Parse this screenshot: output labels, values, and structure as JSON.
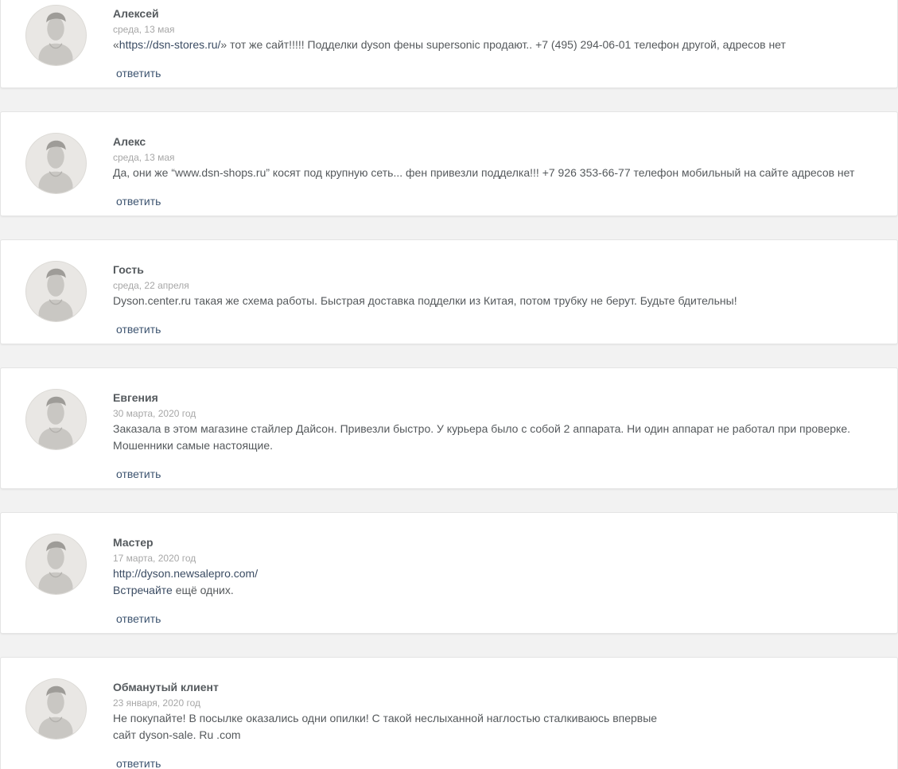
{
  "comments": [
    {
      "author": "Алексей",
      "date": "среда, 13 мая",
      "text_prefix": "«",
      "link": "https://dsn-stores.ru/",
      "text_suffix": "» тот же сайт!!!!! Подделки dyson фены supersonic продают.. +7 (495) 294-06-01 телефон другой, адресов нет",
      "reply_label": "ответить"
    },
    {
      "author": "Алекс",
      "date": "среда, 13 мая",
      "text": "Да, они же “www.dsn-shops.ru” косят под крупную сеть... фен привезли подделка!!! +7 926 353-66-77 телефон мобильный на сайте адресов нет",
      "reply_label": "ответить"
    },
    {
      "author": "Гость",
      "date": "среда, 22 апреля",
      "text": "Dyson.center.ru такая же схема работы. Быстрая доставка подделки из Китая, потом трубку не берут. Будьте бдительны!",
      "reply_label": "ответить"
    },
    {
      "author": "Евгения",
      "date": "30 марта, 2020 год",
      "text": "Заказала в этом магазине стайлер Дайсон. Привезли быстро. У курьера было с собой 2 аппарата. Ни один аппарат не работал при проверке. Мошенники самые настоящие.",
      "reply_label": "ответить"
    },
    {
      "author": "Мастер",
      "date": "17 марта, 2020 год",
      "line1_link": "http://dyson.newsalepro.com/",
      "line2_link": "Встречайте",
      "line2_rest": " ещё одних.",
      "reply_label": "ответить"
    },
    {
      "author": "Обманутый клиент",
      "date": "23 января, 2020 год",
      "line1": "Не покупайте! В посылке оказались одни опилки! С такой неслыханной наглостью сталкиваюсь впервые",
      "line2": "сайт dyson-sale. Ru .com",
      "reply_label": "ответить"
    }
  ]
}
